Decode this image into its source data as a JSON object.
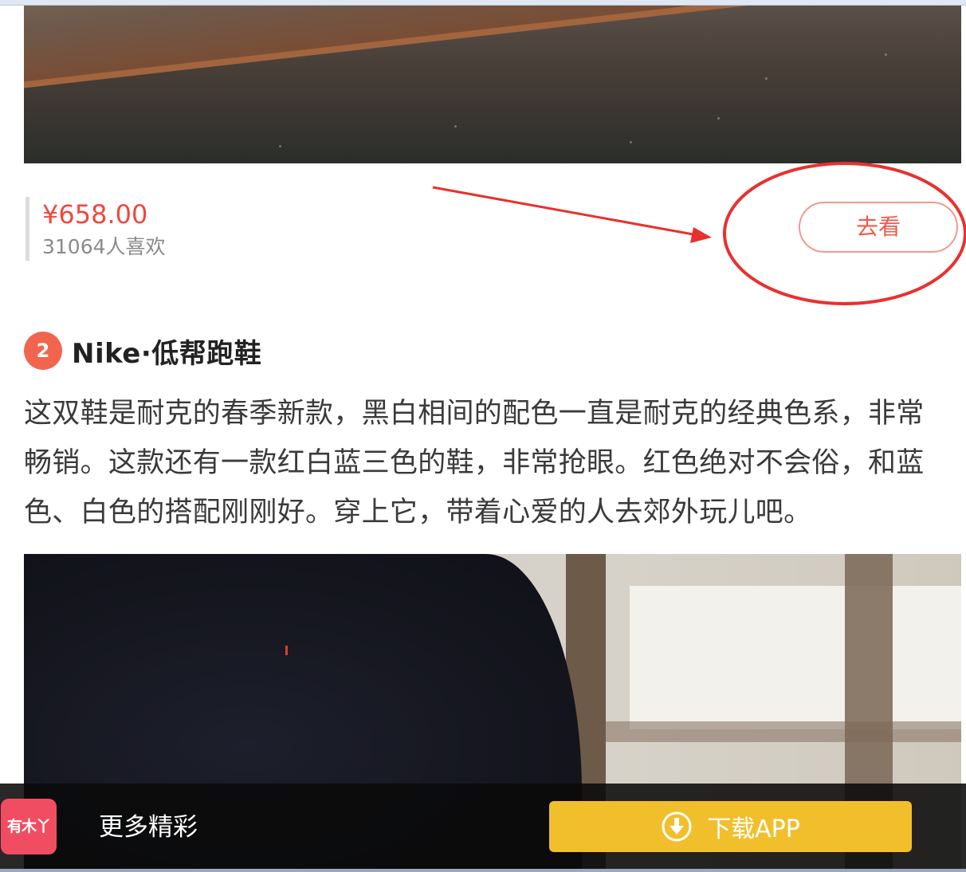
{
  "product1": {
    "price": "¥658.00",
    "likes": "31064人喜欢",
    "go_button": "去看"
  },
  "item2": {
    "number": "2",
    "title": "Nike·低帮跑鞋",
    "description": "这双鞋是耐克的春季新款，黑白相间的配色一直是耐克的经典色系，非常畅销。这款还有一款红白蓝三色的鞋，非常抢眼。红色绝对不会俗，和蓝色、白色的搭配刚刚好。穿上它，带着心爱的人去郊外玩儿吧。"
  },
  "bottom_bar": {
    "logo_text": "有木丫",
    "more_text": "更多精彩",
    "download_label": "下载APP",
    "download_icon": "download-circle-icon"
  },
  "colors": {
    "price_red": "#f0483e",
    "badge": "#f1654f",
    "download_yellow": "#f1bf2c",
    "annotation_red": "#e8312f"
  }
}
